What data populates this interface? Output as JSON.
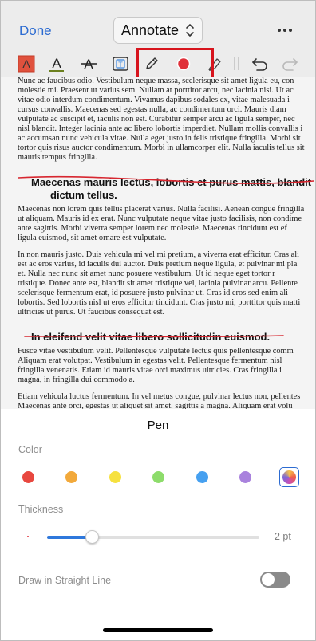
{
  "header": {
    "done_label": "Done",
    "mode_label": "Annotate",
    "more_icon": "ellipsis-icon"
  },
  "toolbar": {
    "tools": [
      "text-highlight-tool",
      "text-underline-tool",
      "text-strikeout-tool",
      "text-box-tool",
      "pen-tool",
      "pen-color-indicator",
      "highlighter-tool",
      "separator",
      "undo-icon",
      "redo-icon"
    ],
    "active_tool": "pen-tool",
    "active_color": "#e0313a"
  },
  "document": {
    "lines_a": [
      "Nunc ac faucibus odio. Vestibulum neque massa, scelerisque sit amet ligula eu, con",
      "molestie mi. Praesent ut varius sem. Nullam at porttitor arcu, nec lacinia nisi. Ut ac",
      "vitae odio interdum condimentum. Vivamus dapibus sodales ex, vitae malesuada i",
      "cursus convallis. Maecenas sed egestas nulla, ac condimentum orci. Mauris diam",
      "vulputate ac suscipit et, iaculis non est. Curabitur semper arcu ac ligula semper, nec",
      "nisl blandit. Integer lacinia ante ac libero lobortis imperdiet. Nullam mollis convallis i",
      "ac accumsan nunc vehicula vitae. Nulla eget justo in felis tristique fringilla. Morbi sit",
      "tortor quis risus auctor condimentum. Morbi in ullamcorper elit. Nulla iaculis tellus sit",
      "mauris tempus fringilla."
    ],
    "heading_1": [
      "Maecenas mauris lectus, lobortis et purus mattis, blandit",
      "dictum tellus."
    ],
    "lines_b": [
      "Maecenas non lorem quis tellus placerat varius. Nulla facilisi. Aenean congue fringilla",
      "ut aliquam. Mauris id ex erat. Nunc vulputate neque vitae justo facilisis, non condime",
      "ante sagittis. Morbi viverra semper lorem nec molestie. Maecenas tincidunt est ef",
      "ligula euismod, sit amet ornare est vulputate."
    ],
    "lines_c": [
      "In non mauris justo. Duis vehicula mi vel mi pretium, a viverra erat efficitur. Cras ali",
      "est ac eros varius, id iaculis dui auctor. Duis pretium neque ligula, et pulvinar mi pla",
      "et. Nulla nec nunc sit amet nunc posuere vestibulum. Ut id neque eget tortor r",
      "tristique. Donec ante est, blandit sit amet tristique vel, lacinia pulvinar arcu. Pellente",
      "scelerisque fermentum erat, id posuere justo pulvinar ut. Cras id eros sed enim ali",
      "lobortis. Sed lobortis nisl ut eros efficitur tincidunt. Cras justo mi, porttitor quis matti",
      "ultricies ut purus. Ut faucibus consequat est."
    ],
    "heading_2": "In eleifend velit vitae libero sollicitudin euismod.",
    "lines_d": [
      "Fusce vitae vestibulum velit. Pellentesque vulputate lectus quis pellentesque comm",
      "Aliquam erat volutpat. Vestibulum in egestas velit. Pellentesque fermentum nisl",
      "fringilla venenatis. Etiam id mauris vitae orci maximus ultricies. Cras fringilla i",
      "magna, in fringilla dui commodo a."
    ],
    "lines_e": [
      "Etiam vehicula luctus fermentum. In vel metus congue, pulvinar lectus non, pellentes",
      "Maecenas ante orci, egestas ut aliquet sit amet, sagittis a magna. Aliquam erat volu"
    ]
  },
  "pen_panel": {
    "title": "Pen",
    "color_label": "Color",
    "colors": [
      "#e8473f",
      "#f2a93b",
      "#f6e13f",
      "#8ddc6b",
      "#46a0f0",
      "#a982dd"
    ],
    "selected_color": "multicolor",
    "thickness_label": "Thickness",
    "thickness_value": "2 pt",
    "thickness_fraction": 0.21,
    "straight_line_label": "Draw in Straight Line",
    "straight_line_on": false
  }
}
